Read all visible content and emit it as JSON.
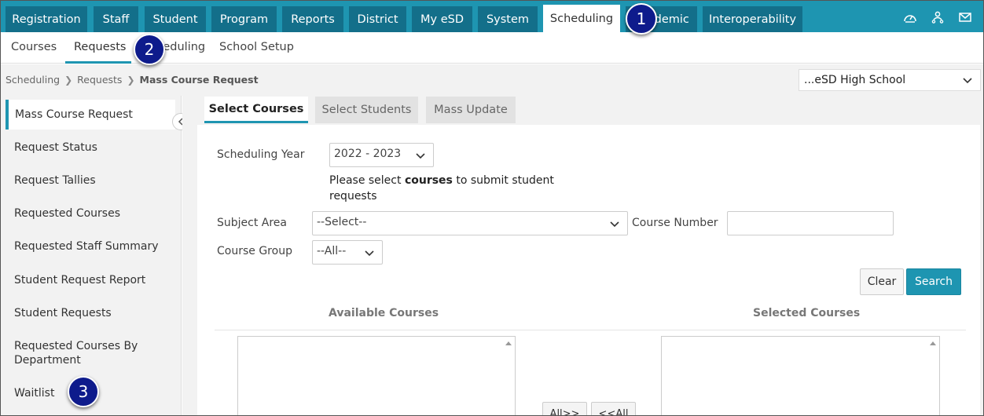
{
  "topnav": {
    "tabs": [
      "Registration",
      "Staff",
      "Student",
      "Program",
      "Reports",
      "District",
      "My eSD",
      "System",
      "Scheduling",
      "Academic",
      "Interoperability"
    ],
    "active": "Scheduling",
    "icons": [
      "dashboard-icon",
      "user-network-icon",
      "mail-icon"
    ]
  },
  "subnav": {
    "tabs": [
      "Courses",
      "Requests",
      "Scheduling",
      "School Setup"
    ],
    "active": "Requests"
  },
  "breadcrumb": {
    "items": [
      "Scheduling",
      "Requests"
    ],
    "current": "Mass Course Request"
  },
  "school_select": {
    "value": "...eSD High School"
  },
  "sidebar": {
    "items": [
      "Mass Course Request",
      "Request Status",
      "Request Tallies",
      "Requested Courses",
      "Requested Staff Summary",
      "Student Request Report",
      "Student Requests",
      "Requested Courses By Department",
      "Waitlist"
    ],
    "active": "Mass Course Request"
  },
  "tabs": [
    "Select Courses",
    "Select Students",
    "Mass Update"
  ],
  "form": {
    "year_label": "Scheduling Year",
    "year_value": "2022 - 2023",
    "note_pre": "Please select ",
    "note_bold": "courses",
    "note_post": " to submit student requests",
    "subject_label": "Subject Area",
    "subject_value": "--Select--",
    "course_number_label": "Course Number",
    "course_number_value": "",
    "course_group_label": "Course Group",
    "course_group_value": "--All--",
    "clear_label": "Clear",
    "search_label": "Search",
    "available_heading": "Available Courses",
    "selected_heading": "Selected Courses",
    "all_right_label": "All>>",
    "all_left_label": "<<All"
  },
  "callouts": [
    "1",
    "2",
    "3"
  ],
  "colors": {
    "accent": "#1e95b1",
    "tab_dark": "#136f8a",
    "callout": "#0e1b8c"
  }
}
